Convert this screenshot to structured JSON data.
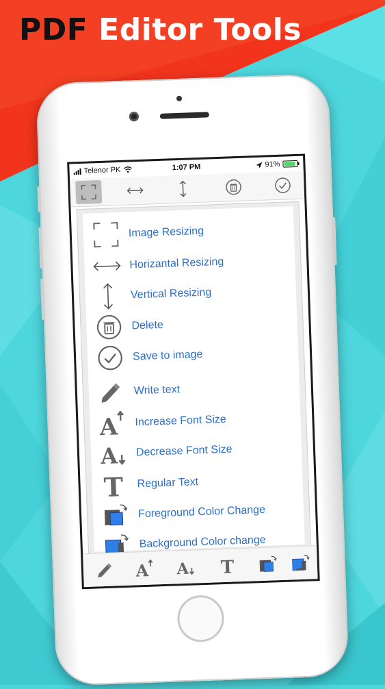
{
  "banner": {
    "title_word1": "PDF",
    "title_word2": "Editor Tools",
    "color_red": "#f2341d",
    "color_teal": "#4ed6dd"
  },
  "status_bar": {
    "carrier": "Telenor PK",
    "time": "1:07 PM",
    "battery": "91%"
  },
  "top_toolbar": {
    "tools": [
      {
        "icon": "image-resize-icon",
        "active": true
      },
      {
        "icon": "horizontal-arrow-icon",
        "active": false
      },
      {
        "icon": "vertical-arrow-icon",
        "active": false
      },
      {
        "icon": "trash-icon",
        "active": false
      },
      {
        "icon": "check-circle-icon",
        "active": false
      }
    ]
  },
  "tool_list": {
    "items": [
      {
        "icon": "image-resize-icon",
        "label": "Image Resizing"
      },
      {
        "icon": "horizontal-arrow-icon",
        "label": "Horizantal Resizing"
      },
      {
        "icon": "vertical-arrow-icon",
        "label": "Vertical Resizing"
      },
      {
        "icon": "trash-icon",
        "label": "Delete"
      },
      {
        "icon": "check-circle-icon",
        "label": "Save to image"
      },
      {
        "icon": "pencil-icon",
        "label": "Write text"
      },
      {
        "icon": "increase-font-icon",
        "label": "Increase Font Size"
      },
      {
        "icon": "decrease-font-icon",
        "label": "Decrease Font Size"
      },
      {
        "icon": "regular-text-icon",
        "label": "Regular Text"
      },
      {
        "icon": "foreground-color-icon",
        "label": "Foreground Color Change"
      },
      {
        "icon": "background-color-icon",
        "label": "Background Color change"
      }
    ],
    "label_color": "#2b6fc9"
  },
  "bottom_toolbar": {
    "tools": [
      {
        "icon": "pencil-icon"
      },
      {
        "icon": "increase-font-icon"
      },
      {
        "icon": "decrease-font-icon"
      },
      {
        "icon": "regular-text-icon"
      },
      {
        "icon": "foreground-color-icon"
      },
      {
        "icon": "background-color-icon"
      }
    ]
  }
}
